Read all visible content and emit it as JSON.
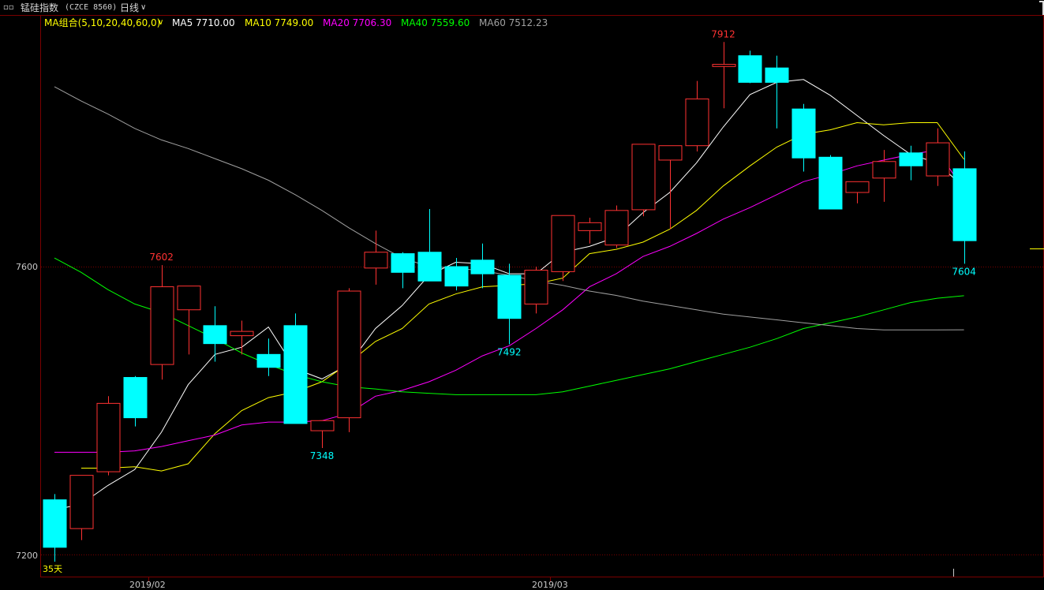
{
  "header": {
    "instrument_name": "锰硅指数",
    "instrument_code": "(CZCE 8560)",
    "period_label": "日线",
    "period_chevron": "chevron-down-icon",
    "menu_icon": "window-menu-icon"
  },
  "legend": {
    "combo_label": "MA组合(5,10,20,40,60,0)",
    "combo_chevron": "chevron-down-icon",
    "items": [
      {
        "label": "MA5 7710.00",
        "color": "#ffffff"
      },
      {
        "label": "MA10 7749.00",
        "color": "#ffff00"
      },
      {
        "label": "MA20 7706.30",
        "color": "#ff00ff"
      },
      {
        "label": "MA40 7559.60",
        "color": "#00ff00"
      },
      {
        "label": "MA60 7512.23",
        "color": "#a0a0a0"
      }
    ]
  },
  "colors": {
    "up": "#ff3232",
    "down": "#00ffff",
    "grid": "#7a0000",
    "axis_text": "#c8c8c8",
    "high_label": "#ff3232",
    "low_label": "#00ffff"
  },
  "chart_data": {
    "type": "candlestick",
    "y_ticks": [
      "7600",
      "7200"
    ],
    "ylim": [
      7180,
      7920
    ],
    "x_labels": [
      "2019/02",
      "2019/03"
    ],
    "corner_label": "35天",
    "annotations": [
      {
        "text": "7912",
        "bar": 25,
        "kind": "high"
      },
      {
        "text": "7602",
        "bar": 4,
        "kind": "high"
      },
      {
        "text": "7348",
        "bar": 10,
        "kind": "low"
      },
      {
        "text": "7492",
        "bar": 17,
        "kind": "low"
      },
      {
        "text": "7604",
        "bar": 34,
        "kind": "low"
      }
    ],
    "candles": [
      {
        "o": 7276,
        "h": 7284,
        "l": 7190,
        "c": 7210
      },
      {
        "o": 7236,
        "h": 7310,
        "l": 7220,
        "c": 7310
      },
      {
        "o": 7315,
        "h": 7420,
        "l": 7310,
        "c": 7410
      },
      {
        "o": 7446,
        "h": 7448,
        "l": 7378,
        "c": 7390
      },
      {
        "o": 7464,
        "h": 7602,
        "l": 7443,
        "c": 7572
      },
      {
        "o": 7540,
        "h": 7573,
        "l": 7478,
        "c": 7573
      },
      {
        "o": 7518,
        "h": 7545,
        "l": 7468,
        "c": 7493
      },
      {
        "o": 7504,
        "h": 7525,
        "l": 7478,
        "c": 7510
      },
      {
        "o": 7478,
        "h": 7500,
        "l": 7448,
        "c": 7460
      },
      {
        "o": 7518,
        "h": 7535,
        "l": 7382,
        "c": 7382
      },
      {
        "o": 7372,
        "h": 7385,
        "l": 7348,
        "c": 7386
      },
      {
        "o": 7390,
        "h": 7570,
        "l": 7370,
        "c": 7566
      },
      {
        "o": 7598,
        "h": 7650,
        "l": 7575,
        "c": 7620
      },
      {
        "o": 7618,
        "h": 7620,
        "l": 7570,
        "c": 7592
      },
      {
        "o": 7620,
        "h": 7680,
        "l": 7580,
        "c": 7580
      },
      {
        "o": 7600,
        "h": 7612,
        "l": 7567,
        "c": 7573
      },
      {
        "o": 7609,
        "h": 7632,
        "l": 7570,
        "c": 7590
      },
      {
        "o": 7588,
        "h": 7604,
        "l": 7492,
        "c": 7528
      },
      {
        "o": 7548,
        "h": 7600,
        "l": 7535,
        "c": 7595
      },
      {
        "o": 7593,
        "h": 7660,
        "l": 7580,
        "c": 7671
      },
      {
        "o": 7650,
        "h": 7668,
        "l": 7632,
        "c": 7661
      },
      {
        "o": 7630,
        "h": 7685,
        "l": 7626,
        "c": 7678
      },
      {
        "o": 7679,
        "h": 7765,
        "l": 7670,
        "c": 7770
      },
      {
        "o": 7748,
        "h": 7765,
        "l": 7652,
        "c": 7768
      },
      {
        "o": 7768,
        "h": 7858,
        "l": 7760,
        "c": 7833
      },
      {
        "o": 7878,
        "h": 7912,
        "l": 7820,
        "c": 7881
      },
      {
        "o": 7893,
        "h": 7900,
        "l": 7855,
        "c": 7856
      },
      {
        "o": 7876,
        "h": 7893,
        "l": 7792,
        "c": 7856
      },
      {
        "o": 7819,
        "h": 7826,
        "l": 7732,
        "c": 7751
      },
      {
        "o": 7752,
        "h": 7755,
        "l": 7680,
        "c": 7680
      },
      {
        "o": 7703,
        "h": 7718,
        "l": 7688,
        "c": 7718
      },
      {
        "o": 7723,
        "h": 7762,
        "l": 7690,
        "c": 7746
      },
      {
        "o": 7758,
        "h": 7768,
        "l": 7720,
        "c": 7740
      },
      {
        "o": 7726,
        "h": 7792,
        "l": 7712,
        "c": 7772
      },
      {
        "o": 7736,
        "h": 7760,
        "l": 7604,
        "c": 7636
      }
    ],
    "series": [
      {
        "name": "MA5",
        "color": "#ffffff",
        "values": [
          7262,
          7270,
          7296,
          7318,
          7370,
          7436,
          7478,
          7488,
          7516,
          7458,
          7444,
          7464,
          7514,
          7546,
          7588,
          7606,
          7604,
          7590,
          7590,
          7620,
          7628,
          7641,
          7675,
          7703,
          7744,
          7794,
          7839,
          7856,
          7860,
          7838,
          7810,
          7782,
          7756,
          7744,
          7710
        ]
      },
      {
        "name": "MA10",
        "color": "#ffff00",
        "values": [
          null,
          7320,
          7320,
          7322,
          7316,
          7326,
          7368,
          7400,
          7418,
          7426,
          7440,
          7466,
          7496,
          7514,
          7548,
          7562,
          7572,
          7574,
          7576,
          7584,
          7618,
          7624,
          7634,
          7652,
          7678,
          7712,
          7740,
          7766,
          7784,
          7790,
          7800,
          7797,
          7800,
          7800,
          7749
        ]
      },
      {
        "name": "MA20",
        "color": "#ff00ff",
        "values": [
          7342,
          7342,
          7342,
          7344,
          7350,
          7358,
          7366,
          7380,
          7384,
          7384,
          7386,
          7396,
          7420,
          7428,
          7440,
          7456,
          7476,
          7490,
          7514,
          7540,
          7572,
          7590,
          7614,
          7628,
          7646,
          7666,
          7682,
          7700,
          7718,
          7728,
          7740,
          7748,
          7756,
          7762,
          7706.3
        ]
      },
      {
        "name": "MA40",
        "color": "#00ff00",
        "values": [
          7612,
          7592,
          7568,
          7548,
          7536,
          7518,
          7500,
          7480,
          7464,
          7450,
          7440,
          7433,
          7430,
          7426,
          7424,
          7422,
          7422,
          7422,
          7422,
          7426,
          7434,
          7442,
          7450,
          7458,
          7468,
          7478,
          7488,
          7500,
          7514,
          7522,
          7530,
          7540,
          7550,
          7556,
          7559.6
        ]
      },
      {
        "name": "MA60",
        "color": "#a0a0a0",
        "values": [
          7850,
          7830,
          7812,
          7792,
          7776,
          7764,
          7750,
          7736,
          7720,
          7700,
          7678,
          7654,
          7632,
          7612,
          7600,
          7598,
          7594,
          7588,
          7580,
          7574,
          7566,
          7560,
          7552,
          7546,
          7540,
          7534,
          7530,
          7526,
          7522,
          7518,
          7514,
          7512,
          7512,
          7512,
          7512.23
        ]
      }
    ]
  }
}
